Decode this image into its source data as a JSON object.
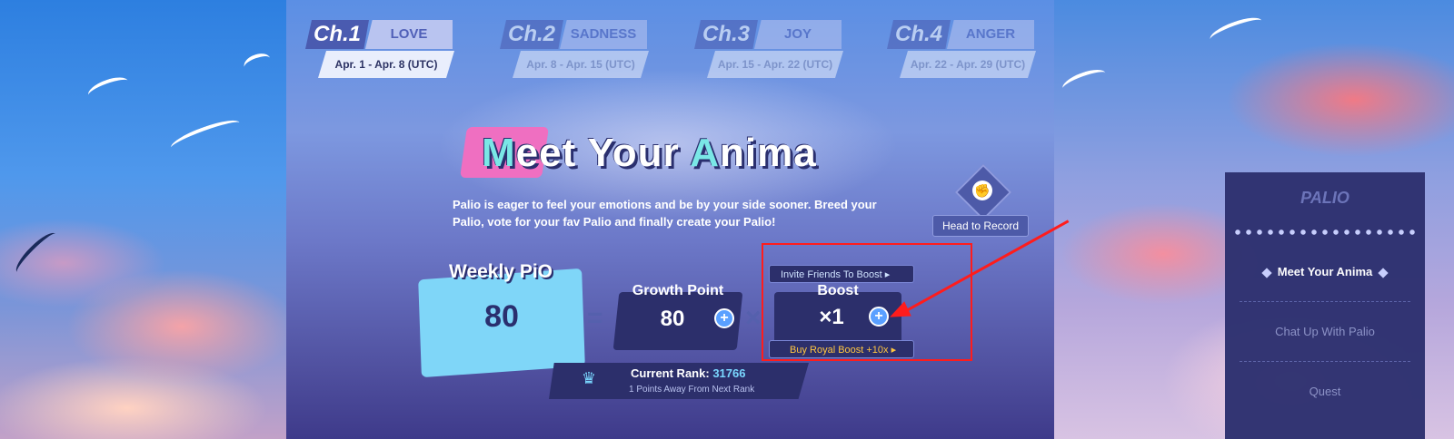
{
  "chapters": [
    {
      "num": "Ch.1",
      "name": "LOVE",
      "dates": "Apr. 1 - Apr. 8 (UTC)"
    },
    {
      "num": "Ch.2",
      "name": "SADNESS",
      "dates": "Apr. 8 - Apr. 15 (UTC)"
    },
    {
      "num": "Ch.3",
      "name": "JOY",
      "dates": "Apr. 15 - Apr. 22 (UTC)"
    },
    {
      "num": "Ch.4",
      "name": "ANGER",
      "dates": "Apr. 22 - Apr. 29 (UTC)"
    }
  ],
  "title": {
    "part1": "M",
    "part2": "eet Your ",
    "part3": "A",
    "part4": "nima"
  },
  "description": "Palio is eager to feel your emotions and be by your side sooner. Breed your Palio, vote for your fav Palio and finally create your Palio!",
  "record": {
    "label": "Head to Record"
  },
  "weekly": {
    "label": "Weekly PiO",
    "value": "80"
  },
  "operators": {
    "equals": "=",
    "times": "×"
  },
  "growth": {
    "label": "Growth Point",
    "value": "80",
    "plus": "+"
  },
  "boost": {
    "label": "Boost",
    "value": "×1",
    "plus": "+",
    "invite": "Invite Friends To Boost",
    "royal": "Buy Royal Boost +10x"
  },
  "rank": {
    "label": "Current Rank:",
    "value": "31766",
    "subtext": "1 Points Away From Next Rank"
  },
  "side_menu": {
    "logo": "PALIO",
    "items": [
      {
        "label": "Meet Your Anima"
      },
      {
        "label": "Chat Up With Palio"
      },
      {
        "label": "Quest"
      }
    ]
  },
  "colors": {
    "highlight": "#ff1c1c",
    "accent": "#7ad7ff",
    "panel": "#2c2f6b"
  }
}
